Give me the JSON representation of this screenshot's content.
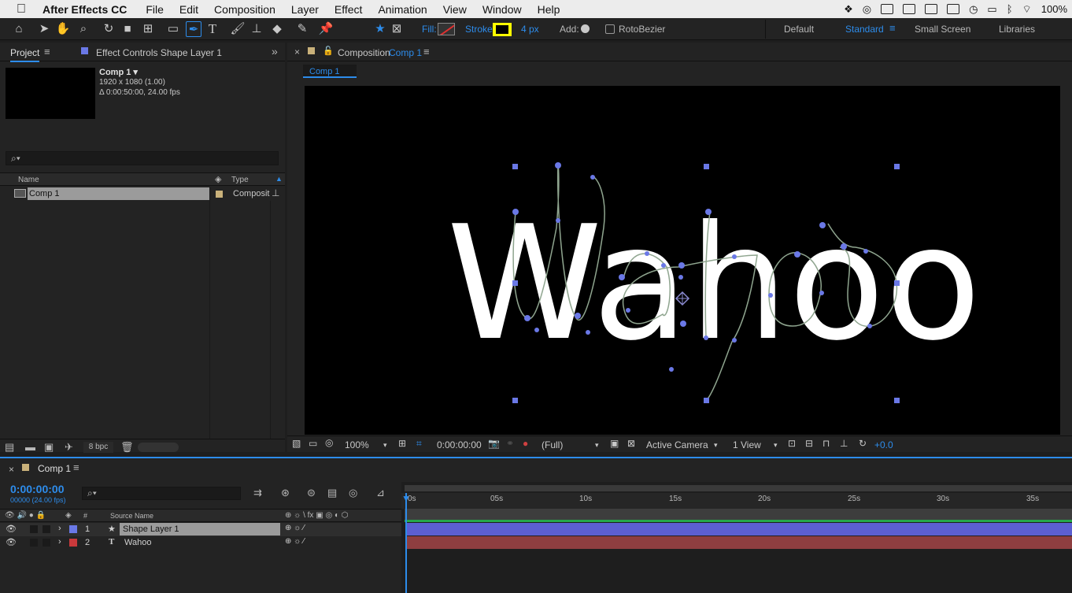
{
  "menubar": {
    "app_name": "After Effects CC",
    "items": [
      "File",
      "Edit",
      "Composition",
      "Layer",
      "Effect",
      "Animation",
      "View",
      "Window",
      "Help"
    ],
    "battery": "100%"
  },
  "toolbar": {
    "fill_label": "Fill:",
    "stroke_label": "Stroke:",
    "stroke_width": "4 px",
    "add_label": "Add:",
    "rotobezier_label": "RotoBezier",
    "workspaces": [
      "Default",
      "Standard",
      "Small Screen",
      "Libraries"
    ],
    "active_workspace": "Standard",
    "stroke_color": "#ffff00",
    "accent": "#2d8ceb"
  },
  "project": {
    "tab_project": "Project",
    "tab_effect_controls": "Effect Controls Shape Layer 1",
    "comp_name": "Comp 1 ▾",
    "comp_size": "1920 x 1080 (1.00)",
    "comp_duration": "Δ 0:00:50:00, 24.00 fps",
    "col_name": "Name",
    "col_type": "Type",
    "items": [
      {
        "name": "Comp 1",
        "type": "Composit"
      }
    ],
    "bpc": "8 bpc"
  },
  "composition": {
    "tab_prefix": "Composition",
    "tab_name": "Comp 1",
    "breadcrumb": "Comp 1",
    "text": "Wahoo",
    "zoom": "100%",
    "timecode": "0:00:00:00",
    "resolution": "(Full)",
    "camera": "Active Camera",
    "views": "1 View",
    "exposure": "+0.0"
  },
  "timeline": {
    "tab_name": "Comp 1",
    "current_time": "0:00:00:00",
    "frame_info": "00000 (24.00 fps)",
    "col_hash": "#",
    "col_source": "Source Name",
    "ticks": [
      "0s",
      "05s",
      "10s",
      "15s",
      "20s",
      "25s",
      "30s",
      "35s"
    ],
    "layers": [
      {
        "num": "1",
        "name": "Shape Layer 1",
        "color": "#6a78e6",
        "bar": "#5c5fd1"
      },
      {
        "num": "2",
        "name": "Wahoo",
        "color": "#c9393b",
        "bar": "#8e3e40"
      }
    ]
  }
}
